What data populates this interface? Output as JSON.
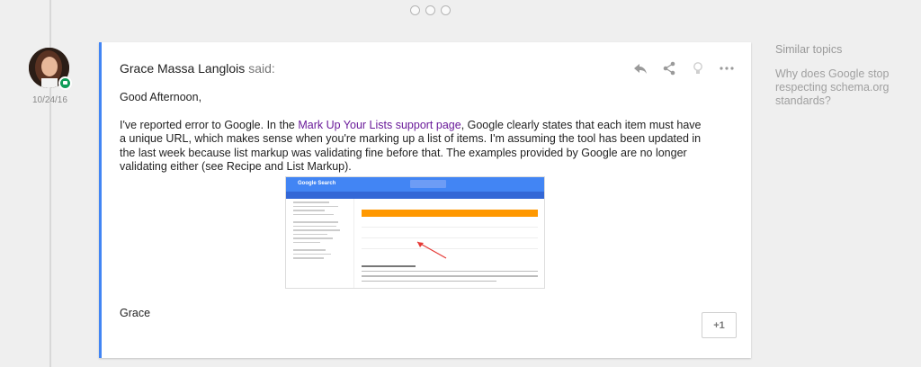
{
  "post": {
    "author": "Grace Massa Langlois",
    "said_label": "said:",
    "date": "10/24/16",
    "greeting": "Good Afternoon,",
    "para_part1": "I've reported error to Google. In the ",
    "link_text": "Mark Up Your Lists support page",
    "para_part2": ", Google clearly states that each item must have a unique URL, which makes sense when you're marking up a list of items. I'm assuming the tool has been updated in the last week because list markup was validating fine before that. The examples provided by Google are no longer validating either (see Recipe and List Markup).",
    "signature": "Grace",
    "plus_one": "+1",
    "actions": [
      "reply-icon",
      "share-icon",
      "lightbulb-icon",
      "more-icon"
    ]
  },
  "embedded_screenshot": {
    "app_name": "Google Search"
  },
  "sidebar": {
    "title": "Similar topics",
    "topics": [
      "Why does Google stop respecting schema.org standards?"
    ]
  },
  "colors": {
    "accent": "#4285f4",
    "link": "#6a1b9a",
    "badge": "#0f9d58",
    "table_header": "#ff9800"
  }
}
